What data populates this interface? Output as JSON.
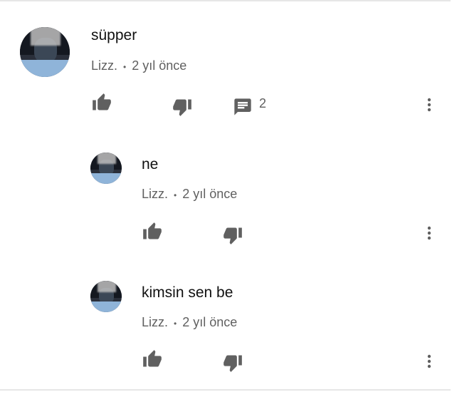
{
  "comments": [
    {
      "text": "süpper",
      "author": "Lizz.",
      "separator": "•",
      "time": "2 yıl önce",
      "reply_count": "2"
    },
    {
      "text": "ne",
      "author": "Lizz.",
      "separator": "•",
      "time": "2 yıl önce"
    },
    {
      "text": "kimsin sen be",
      "author": "Lizz.",
      "separator": "•",
      "time": "2 yıl önce"
    }
  ],
  "icons": {
    "like": "thumb-up-icon",
    "dislike": "thumb-down-icon",
    "reply": "comment-icon",
    "more": "more-vert-icon"
  },
  "colors": {
    "text": "#111111",
    "meta": "#606060",
    "icon": "#606060"
  }
}
